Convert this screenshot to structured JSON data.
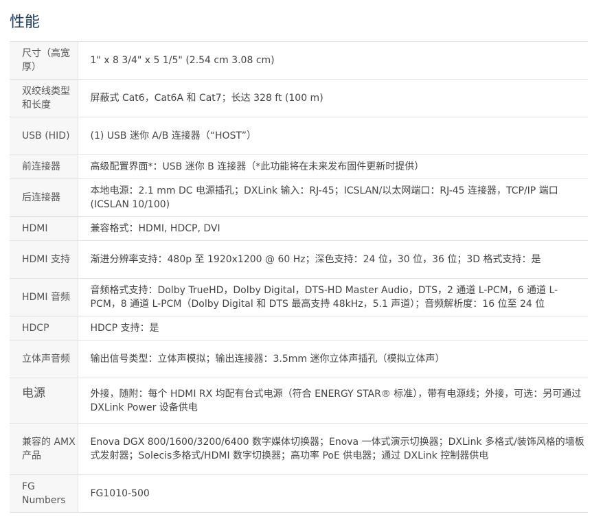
{
  "section_title": "性能",
  "specs": [
    {
      "label": "尺寸（高宽厚）",
      "value": "1\" x 8 3/4\" x 5 1/5\" (2.54 cm 3.08 cm)"
    },
    {
      "label": "双绞线类型和长度",
      "value": "屏蔽式 Cat6，Cat6A 和 Cat7；长达 328 ft (100 m)"
    },
    {
      "label": "USB (HID)",
      "value": "(1) USB 迷你 A/B 连接器（“HOST”）"
    },
    {
      "label": "前连接器",
      "value": "高级配置界面*：USB 迷你 B 连接器（*此功能将在未来发布固件更新时提供）"
    },
    {
      "label": "后连接器",
      "value": "本地电源：2.1 mm DC 电源插孔；DXLink 输入：RJ-45；ICSLAN/以太网端口：RJ-45 连接器，TCP/IP 端口 (ICSLAN 10/100)"
    },
    {
      "label": "HDMI",
      "value": "兼容格式：HDMI, HDCP, DVI"
    },
    {
      "label": "HDMI 支持",
      "value": "渐进分辨率支持：480p 至 1920x1200 @ 60 Hz；深色支持：24 位，30 位，36 位；3D 格式支持：是"
    },
    {
      "label": "HDMI 音频",
      "value": "音频格式支持：Dolby TrueHD，Dolby Digital，DTS-HD Master Audio，DTS，2 通道 L-PCM，6 通道 L-PCM，8 通道 L-PCM（Dolby Digital 和 DTS 最高支持 48kHz，5.1 声道）；音频解析度：16 位至 24 位"
    },
    {
      "label": "HDCP",
      "value": "HDCP 支持：是"
    },
    {
      "label": "立体声音频",
      "value": "输出信号类型：立体声模拟；输出连接器：3.5mm 迷你立体声插孔（模拟立体声）"
    },
    {
      "label": "电源",
      "value": "外接，随附：每个 HDMI RX 均配有台式电源（符合 ENERGY STAR® 标准），带有电源线；外接，可选：另可通过 DXLink Power 设备供电"
    },
    {
      "label": "兼容的 AMX 产品",
      "value": "Enova DGX 800/1600/3200/6400 数字媒体切换器；Enova 一体式演示切换器；DXLink 多格式/装饰风格的墙板式发射器；Solecis多格式/HDMI 数字切换器；高功率 PoE 供电器；通过 DXLink 控制器供电"
    },
    {
      "label": "FG Numbers",
      "value": "FG1010-500"
    }
  ]
}
